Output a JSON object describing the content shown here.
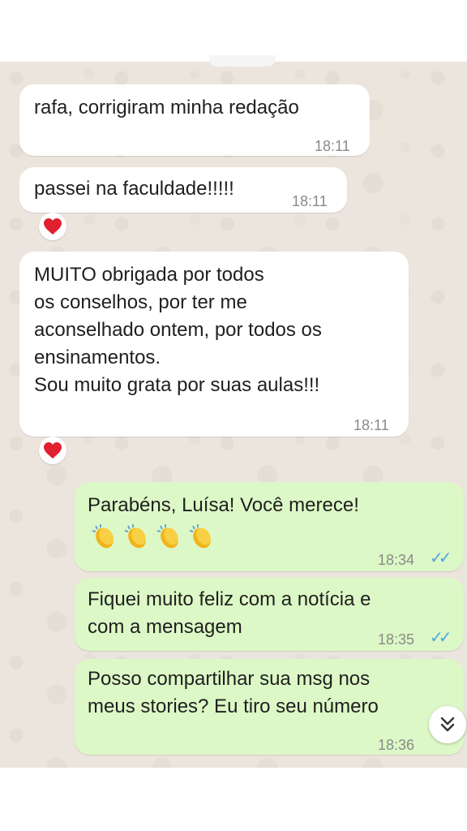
{
  "messages": [
    {
      "text": "rafa, corrigiram minha redação",
      "time": "18:11"
    },
    {
      "text": "passei na faculdade!!!!!",
      "time": "18:11",
      "reaction": "heart"
    },
    {
      "lines": [
        "MUITO obrigada por todos",
        "os conselhos, por ter me",
        "aconselhado ontem, por todos os",
        "ensinamentos.",
        "Sou muito grata por suas aulas!!!"
      ],
      "time": "18:11",
      "reaction": "heart"
    },
    {
      "text": "Parabéns, Luísa! Você merece!",
      "emoji": "clapping-hands x4",
      "time": "18:34",
      "status": "read"
    },
    {
      "lines": [
        "Fiquei muito feliz com a notícia e",
        "com a mensagem"
      ],
      "time": "18:35",
      "status": "read"
    },
    {
      "lines": [
        "Posso compartilhar sua msg nos",
        "meus stories? Eu tiro seu número"
      ],
      "time": "18:36",
      "status": "read"
    }
  ],
  "colors": {
    "incoming": "#ffffff",
    "outgoing": "#dcf8c6",
    "chat_bg": "#ece5dd",
    "tick": "#4fa3e0",
    "heart": "#e0202f"
  },
  "icons": {
    "reaction": "heart-icon",
    "scroll": "chevron-double-down-icon",
    "status": "double-check-icon"
  }
}
